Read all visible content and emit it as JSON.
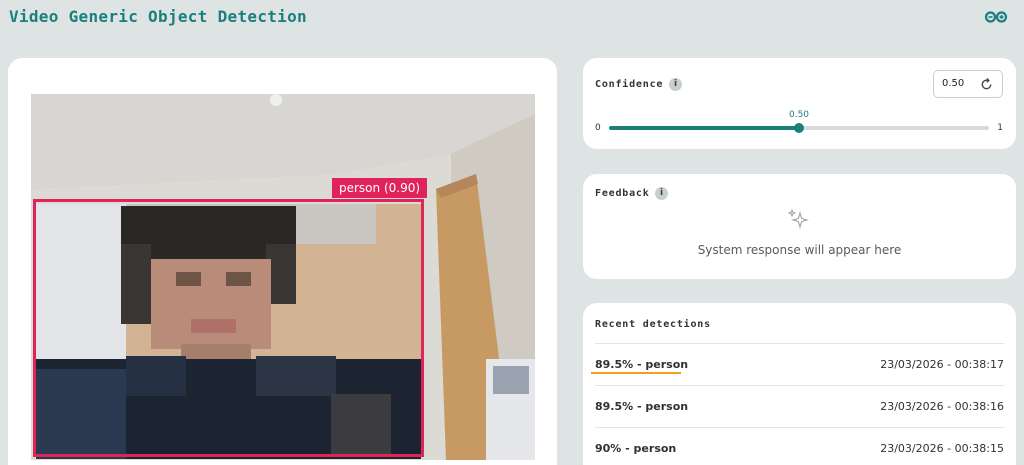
{
  "header": {
    "title": "Video Generic Object Detection",
    "logo_icon": "infinity-logo-icon",
    "accent_color": "#1b7f7d"
  },
  "video": {
    "detection_label": "person (0.90)",
    "box_color": "#e0245a"
  },
  "confidence": {
    "heading": "Confidence",
    "info_icon": "i",
    "value": "0.50",
    "min_label": "0",
    "max_label": "1",
    "slider_value": 0.5,
    "slider_bubble": "0.50"
  },
  "feedback": {
    "heading": "Feedback",
    "info_icon": "i",
    "empty_message": "System response will appear here"
  },
  "recent": {
    "heading": "Recent detections",
    "items": [
      {
        "label": "89.5% - person",
        "time": "23/03/2026 - 00:38:17"
      },
      {
        "label": "89.5% - person",
        "time": "23/03/2026 - 00:38:16"
      },
      {
        "label": "90% - person",
        "time": "23/03/2026 - 00:38:15"
      }
    ]
  }
}
